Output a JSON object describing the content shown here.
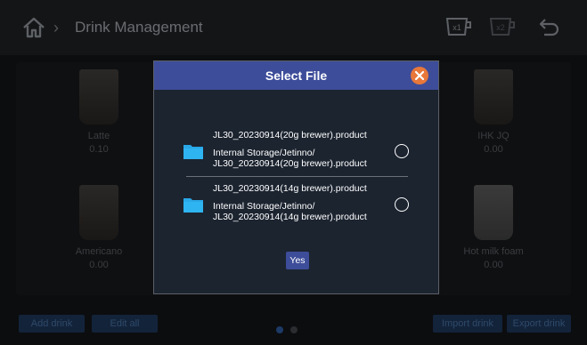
{
  "header": {
    "title": "Drink Management",
    "icons": [
      "home-icon",
      "chevron-right-icon",
      "cup-x1-icon",
      "cup-x2-icon",
      "back-icon"
    ]
  },
  "drinks": [
    {
      "name": "Latte",
      "price": "0.10"
    },
    {
      "name": "IHK JQ",
      "price": "0.00"
    },
    {
      "name": "Americano",
      "price": "0.00"
    },
    {
      "name": "Hot milk foam",
      "price": "0.00"
    }
  ],
  "bottom": {
    "add_drink": "Add drink",
    "edit_all": "Edit all",
    "import_drink": "Import drink",
    "export_drink": "Export drink"
  },
  "dialog": {
    "title": "Select File",
    "files": [
      {
        "name": "JL30_20230914(20g brewer).product",
        "path_line1": "Internal Storage/Jetinno/",
        "path_line2": "JL30_20230914(20g brewer).product"
      },
      {
        "name": "JL30_20230914(14g brewer).product",
        "path_line1": "Internal Storage/Jetinno/",
        "path_line2": "JL30_20230914(14g brewer).product"
      }
    ],
    "confirm_label": "Yes"
  },
  "colors": {
    "dialog_header": "#3d4d9a",
    "close_button": "#e8773a",
    "folder": "#29a8e8"
  }
}
